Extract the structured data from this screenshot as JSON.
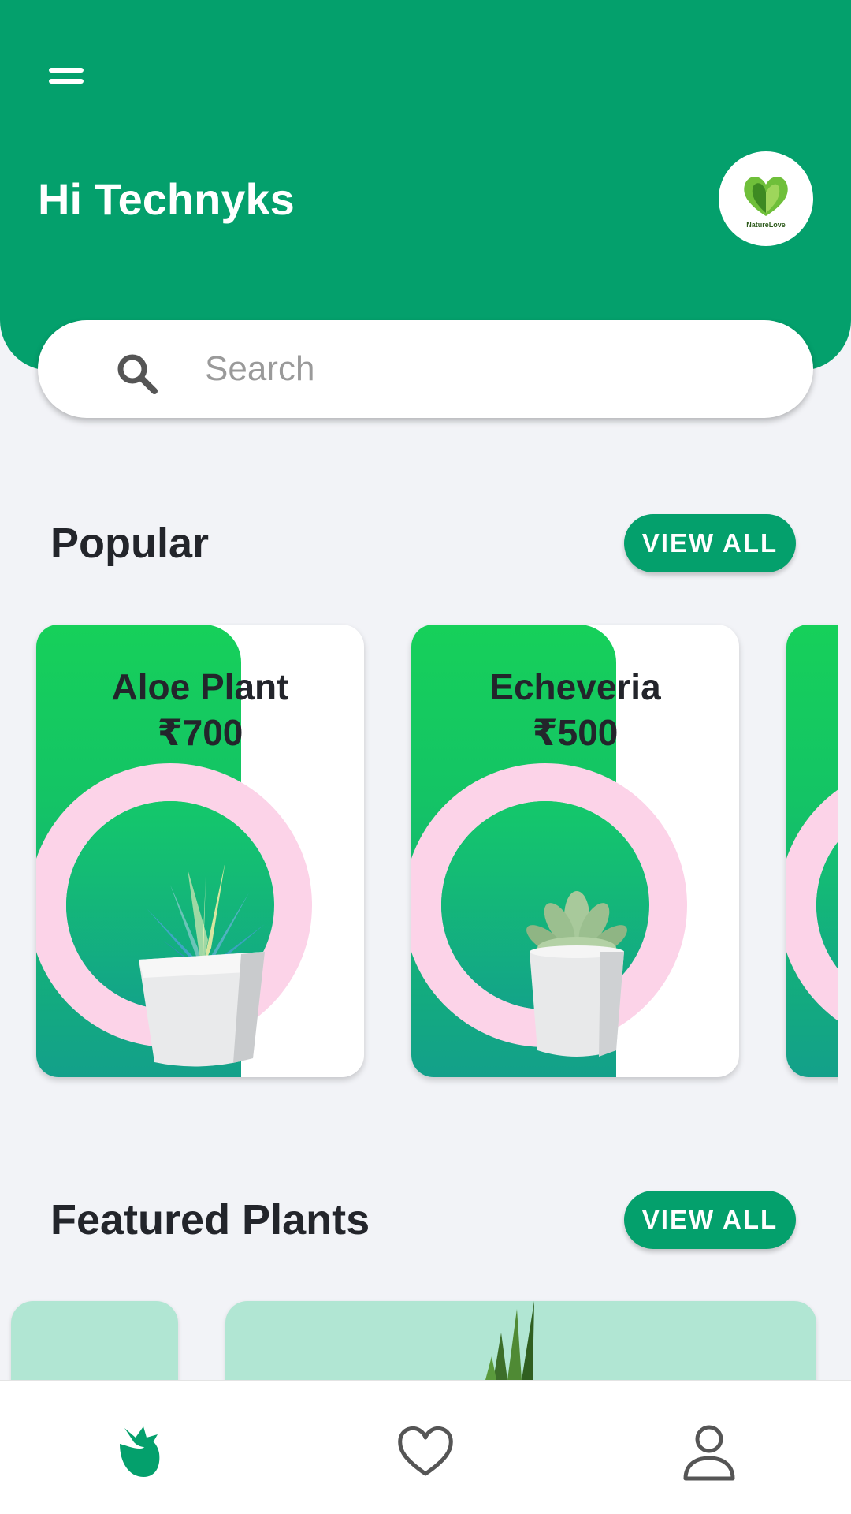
{
  "header": {
    "greeting": "Hi Technyks",
    "menu_icon": "menu-icon",
    "logo_text": "NatureLove",
    "bg_color": "#04a06c"
  },
  "search": {
    "placeholder": "Search",
    "icon": "search-icon"
  },
  "popular": {
    "title": "Popular",
    "view_all_label": "VIEW ALL",
    "items": [
      {
        "name": "Aloe Plant",
        "price": "₹700"
      },
      {
        "name": "Echeveria",
        "price": "₹500"
      },
      {
        "name": "",
        "price": ""
      }
    ]
  },
  "featured": {
    "title": "Featured Plants",
    "view_all_label": "VIEW ALL"
  },
  "bottom_nav": {
    "items": [
      {
        "icon": "plant-icon",
        "active": true
      },
      {
        "icon": "heart-icon",
        "active": false
      },
      {
        "icon": "profile-icon",
        "active": false
      }
    ]
  },
  "colors": {
    "accent": "#04a06c",
    "ring": "#fcd3e8",
    "card_green": "#16d05a",
    "card_teal": "#13a08a",
    "featured_bg": "#b1e6d3"
  }
}
